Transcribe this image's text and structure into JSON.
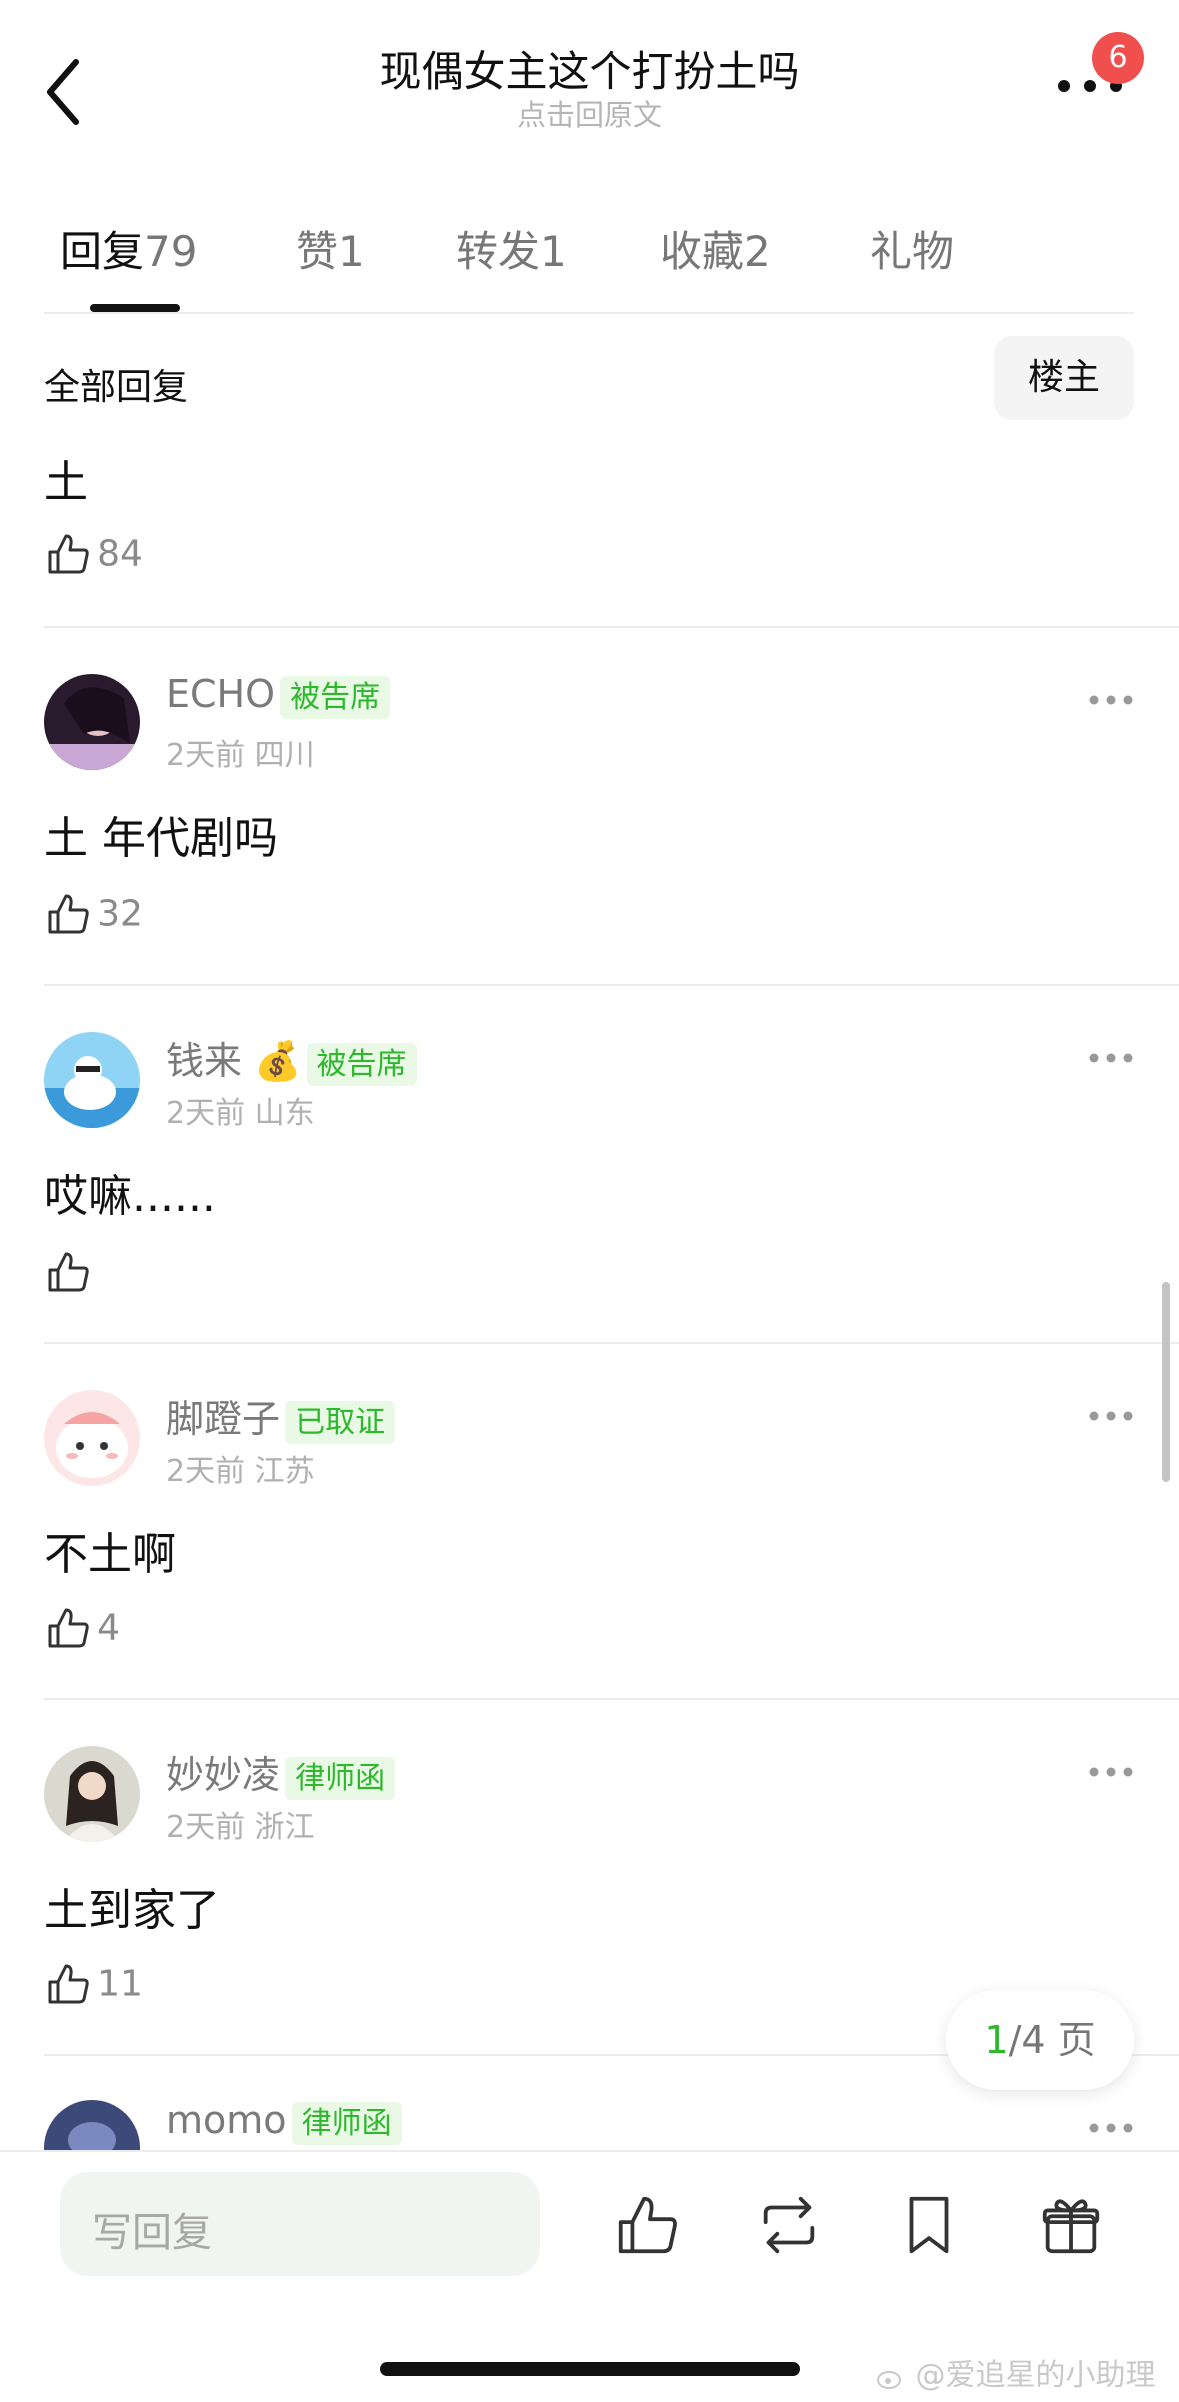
{
  "header": {
    "title": "现偶女主这个打扮土吗",
    "subtitle": "点击回原文",
    "badge_count": "6"
  },
  "tabs": [
    {
      "label": "回复",
      "count": "79",
      "active": true
    },
    {
      "label": "赞",
      "count": "1"
    },
    {
      "label": "转发",
      "count": "1"
    },
    {
      "label": "收藏",
      "count": "2"
    },
    {
      "label": "礼物",
      "count": ""
    }
  ],
  "filter": {
    "all_label": "全部回复",
    "op_label": "楼主"
  },
  "first_comment": {
    "text": "土",
    "likes": "84"
  },
  "comments": [
    {
      "name": "ECHO",
      "tag": "被告席",
      "time": "2天前",
      "location": "四川",
      "text": "土 年代剧吗",
      "likes": "32"
    },
    {
      "name": "钱来 💰",
      "tag": "被告席",
      "time": "2天前",
      "location": "山东",
      "text": "哎嘛......",
      "likes": ""
    },
    {
      "name": "脚蹬子",
      "tag": "已取证",
      "time": "2天前",
      "location": "江苏",
      "text": "不土啊",
      "likes": "4"
    },
    {
      "name": "妙妙凌",
      "tag": "律师函",
      "time": "2天前",
      "location": "浙江",
      "text": "土到家了",
      "likes": "11"
    },
    {
      "name": "momo",
      "tag": "律师函",
      "time": "",
      "location": "",
      "text": "",
      "likes": ""
    }
  ],
  "pager": {
    "current": "1",
    "total": "/4 页"
  },
  "bottom_bar": {
    "placeholder": "写回复"
  },
  "watermark": "@爱追星的小助理",
  "colors": {
    "accent_green": "#2eb82e",
    "badge_red": "#f14e4e"
  }
}
